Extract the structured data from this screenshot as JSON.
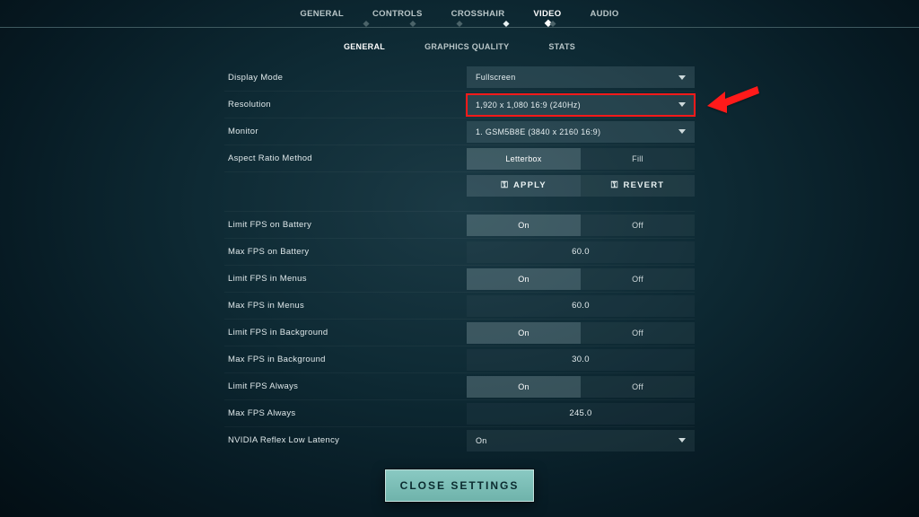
{
  "topTabs": [
    "GENERAL",
    "CONTROLS",
    "CROSSHAIR",
    "VIDEO",
    "AUDIO"
  ],
  "topActiveIndex": 3,
  "subTabs": [
    "GENERAL",
    "GRAPHICS QUALITY",
    "STATS"
  ],
  "subActiveIndex": 0,
  "rows": {
    "displayMode": {
      "label": "Display Mode",
      "value": "Fullscreen"
    },
    "resolution": {
      "label": "Resolution",
      "value": "1,920 x 1,080 16:9 (240Hz)"
    },
    "monitor": {
      "label": "Monitor",
      "value": "1. GSM5B8E (3840 x  2160 16:9)"
    },
    "aspectRatio": {
      "label": "Aspect Ratio Method",
      "options": [
        "Letterbox",
        "Fill"
      ],
      "selected": 0
    },
    "apply": "APPLY",
    "revert": "REVERT",
    "limitBattery": {
      "label": "Limit FPS on Battery",
      "options": [
        "On",
        "Off"
      ],
      "selected": 0
    },
    "maxBattery": {
      "label": "Max FPS on Battery",
      "value": "60.0"
    },
    "limitMenus": {
      "label": "Limit FPS in Menus",
      "options": [
        "On",
        "Off"
      ],
      "selected": 0
    },
    "maxMenus": {
      "label": "Max FPS in Menus",
      "value": "60.0"
    },
    "limitBackground": {
      "label": "Limit FPS in Background",
      "options": [
        "On",
        "Off"
      ],
      "selected": 0
    },
    "maxBackground": {
      "label": "Max FPS in Background",
      "value": "30.0"
    },
    "limitAlways": {
      "label": "Limit FPS Always",
      "options": [
        "On",
        "Off"
      ],
      "selected": 0
    },
    "maxAlways": {
      "label": "Max FPS Always",
      "value": "245.0"
    },
    "reflex": {
      "label": "NVIDIA Reflex Low Latency",
      "value": "On"
    }
  },
  "closeLabel": "CLOSE SETTINGS",
  "lockGlyph": "⚿"
}
